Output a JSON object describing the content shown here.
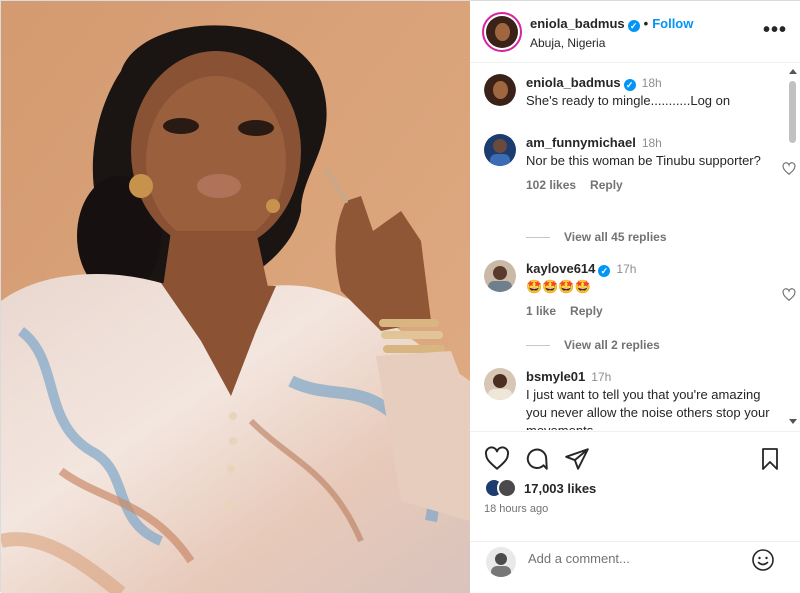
{
  "post": {
    "author": "eniola_badmus",
    "follow_label": "Follow",
    "separator": "•",
    "location": "Abuja, Nigeria",
    "more_label": "•••",
    "verified_mark": "✓"
  },
  "comments": [
    {
      "user": "eniola_badmus",
      "time": "18h",
      "text": "She's ready to mingle...........Log on",
      "verified": true
    },
    {
      "user": "am_funnymichael",
      "time": "18h",
      "text": "Nor be this woman be Tinubu supporter?",
      "likes": "102 likes",
      "reply_label": "Reply",
      "view_replies": "View all 45 replies"
    },
    {
      "user": "kaylove614",
      "time": "17h",
      "text": "🤩🤩🤩🤩",
      "verified": true,
      "likes": "1 like",
      "reply_label": "Reply",
      "view_replies": "View all 2 replies"
    },
    {
      "user": "bsmyle01",
      "time": "17h",
      "text": "I just want to tell you that you're amazing you never allow the noise others stop your movements"
    }
  ],
  "actions": {
    "like_icon": "heart-icon",
    "comment_icon": "comment-icon",
    "share_icon": "share-icon",
    "save_icon": "bookmark-icon"
  },
  "likes_count": "17,003 likes",
  "post_time": "18 hours ago",
  "add_comment": {
    "placeholder": "Add a comment...",
    "emoji_icon": "smiley-icon"
  },
  "colors": {
    "accent": "#0095f6",
    "background_photo": "#d9a37a",
    "text": "#262626",
    "muted": "#737373"
  }
}
